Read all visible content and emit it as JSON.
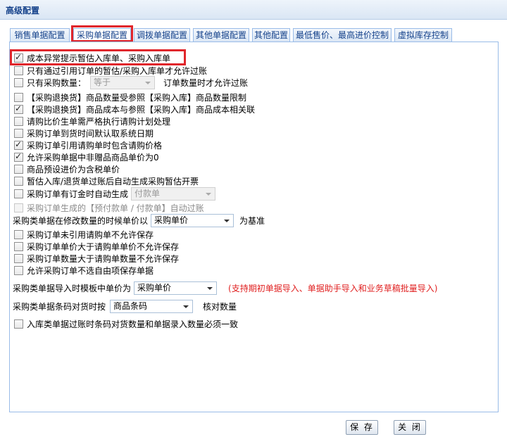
{
  "window": {
    "title": "高级配置"
  },
  "tabs": [
    {
      "label": "销售单据配置"
    },
    {
      "label": "采购单据配置"
    },
    {
      "label": "调拨单据配置"
    },
    {
      "label": "其他单据配置"
    },
    {
      "label": "其他配置"
    },
    {
      "label": "最低售价、最高进价控制"
    },
    {
      "label": "虚拟库存控制"
    }
  ],
  "active_tab": "采购单据配置",
  "options": [
    {
      "label": "成本异常提示暂估入库单、采购入库单",
      "checked": true
    },
    {
      "label": "只有通过引用订单的暂估/采购入库单才允许过账",
      "checked": false
    },
    {
      "prefix": "只有采购数量：",
      "select": "等于",
      "suffix": "订单数量时才允许过账",
      "checked": false
    },
    {
      "label": "【采购退换货】商品数量受参照【采购入库】商品数量限制",
      "checked": false
    },
    {
      "label": "【采购退换货】商品成本与参照【采购入库】商品成本相关联",
      "checked": true
    },
    {
      "label": "请购比价生单需严格执行请购计划处理",
      "checked": false
    },
    {
      "label": "采购订单到货时间默认取系统日期",
      "checked": false
    },
    {
      "label": "采购订单引用请购单时包含请购价格",
      "checked": true
    },
    {
      "label": "允许采购单据中非赠品商品单价为0",
      "checked": true
    },
    {
      "label": "商品预设进价为含税单价",
      "checked": false
    },
    {
      "label": "暂估入库/退货单过账后自动生成采购暂估开票",
      "checked": false
    },
    {
      "prefix": "采购订单有订金时自动生成",
      "select": "付款单",
      "checked": false
    },
    {
      "label": "采购订单生成的【预付款单 / 付款单】自动过账",
      "checked": false,
      "disabled": true
    }
  ],
  "price_basis": {
    "prefix": "采购类单据在修改数量的时候单价以",
    "select": "采购单价",
    "suffix": "为基准"
  },
  "options2": [
    {
      "label": "采购订单未引用请购单不允许保存",
      "checked": false
    },
    {
      "label": "采购订单单价大于请购单单价不允许保存",
      "checked": false
    },
    {
      "label": "采购订单数量大于请购单数量不允许保存",
      "checked": false
    },
    {
      "label": "允许采购订单不选自由项保存单据",
      "checked": false
    }
  ],
  "import_price": {
    "prefix": "采购类单据导入时模板中单价为",
    "select": "采购单价",
    "note": "(支持期初单据导入、单据助手导入和业务草稿批量导入)"
  },
  "barcode": {
    "prefix": "采购类单据条码对货时按",
    "select": "商品条码",
    "suffix": "核对数量"
  },
  "final_option": {
    "label": "入库类单据过账时条码对货数量和单据录入数量必须一致",
    "checked": false
  },
  "buttons": {
    "save": "保 存",
    "close": "关 闭"
  },
  "colors": {
    "highlight": "#e0262b",
    "note": "#e02020",
    "tab_text": "#15428b"
  }
}
